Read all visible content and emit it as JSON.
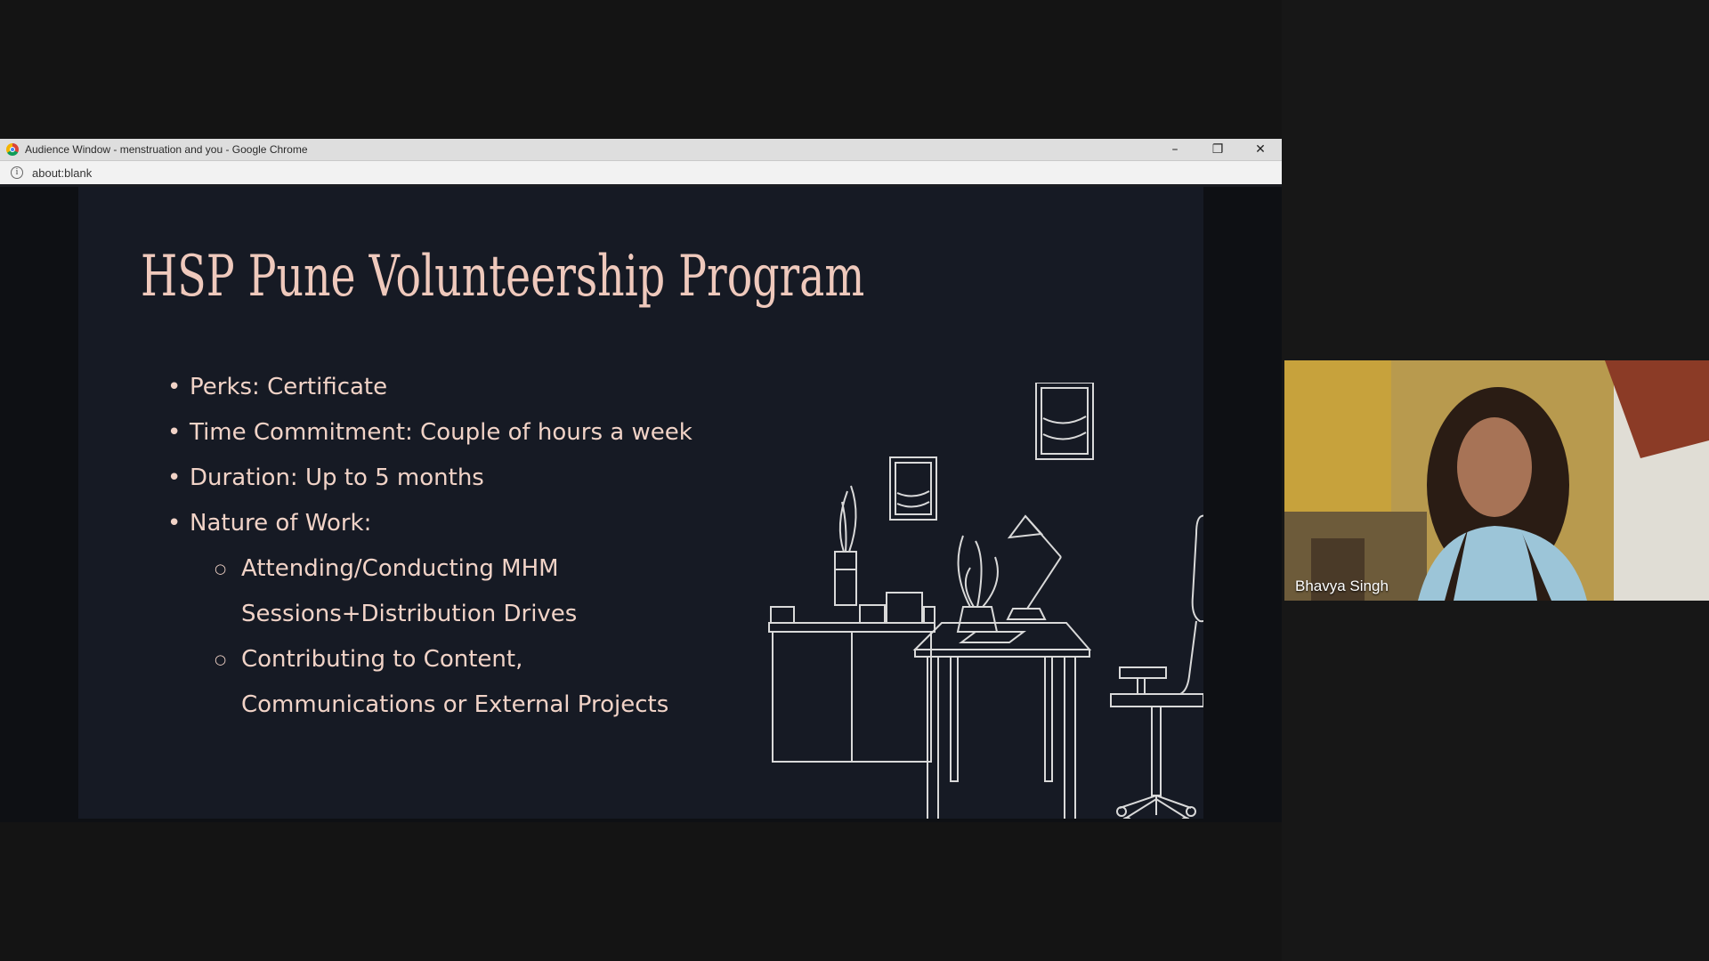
{
  "browser": {
    "title": "Audience Window - menstruation and you - Google Chrome",
    "url": "about:blank",
    "controls": {
      "minimize": "–",
      "restore": "❐",
      "close": "✕"
    },
    "info_icon": "i"
  },
  "slide": {
    "title": "HSP Pune Volunteership Program",
    "bullets": [
      "Perks: Certificate",
      "Time Commitment: Couple of hours a week",
      "Duration: Up to 5 months",
      "Nature of Work:"
    ],
    "sub_bullets": [
      "Attending/Conducting MHM Sessions+Distribution Drives",
      "Contributing to Content, Communications or External Projects"
    ]
  },
  "participant": {
    "name": "Bhavya Singh"
  },
  "colors": {
    "slide_bg": "#161a24",
    "title": "#efc9bc",
    "text": "#f1d3c7",
    "illustration": "#d9d9d9"
  },
  "icons": [
    "chrome-logo-icon",
    "info-icon",
    "minimize-icon",
    "restore-icon",
    "close-icon"
  ]
}
